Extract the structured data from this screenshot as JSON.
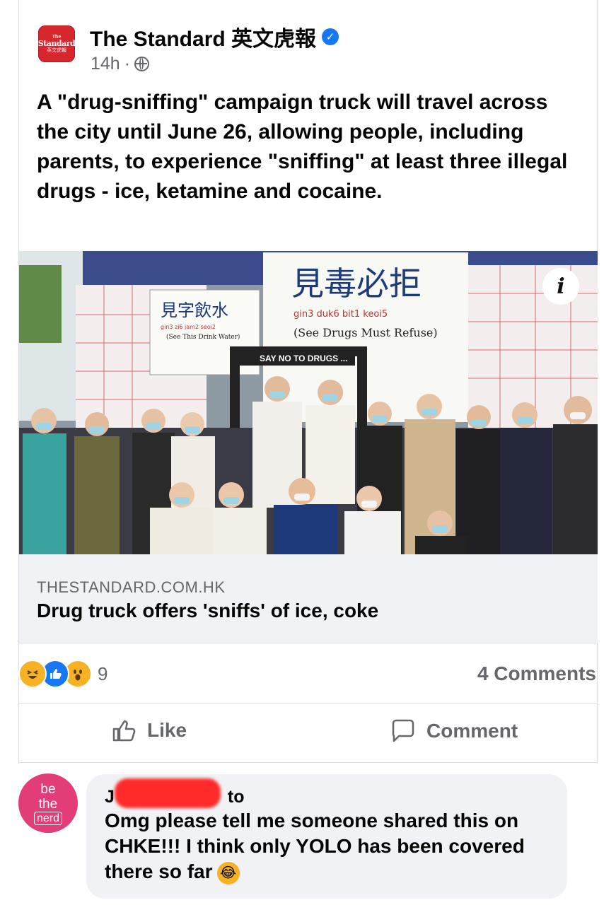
{
  "post": {
    "page_name": "The Standard 英文虎報",
    "avatar_logo": {
      "top": "The",
      "mid": "Standard",
      "bot": "英文虎報"
    },
    "time": "14h",
    "separator": "·",
    "privacy_icon": "globe-icon",
    "text": "A \"drug-sniffing\" campaign truck will travel across the city until June 26, allowing people, including parents, to experience \"sniffing\" at least three illegal drugs - ice, ketamine and cocaine."
  },
  "photo": {
    "banner_main": "見毒必拒",
    "banner_main_romanization": "gin3   duk6   bit1   keoi5",
    "banner_main_translation": "(See Drugs Must Refuse)",
    "banner_left": "見字飲水",
    "banner_left_romanization": "gin3  zi6  jam2  seoi2",
    "banner_left_translation": "(See This Drink Water)",
    "frame_label": "SAY NO TO DRUGS ...",
    "info_icon_glyph": "i"
  },
  "link_card": {
    "domain": "THESTANDARD.COM.HK",
    "title": "Drug truck offers 'sniffs' of ice, coke"
  },
  "reactions": {
    "icons": [
      "haha-icon",
      "like-icon",
      "wow-icon"
    ],
    "count": "9",
    "comments": "4 Comments"
  },
  "actions": {
    "like_label": "Like",
    "comment_label": "Comment"
  },
  "comment": {
    "avatar_lines": [
      "be",
      "the",
      "nerd"
    ],
    "name_start": "J",
    "name_end": "to",
    "text": "Omg please tell me someone shared this on CHKE!!! I think only YOLO has been covered there so far",
    "emoji": "😂"
  },
  "colors": {
    "brand_blue": "#1877f2",
    "secondary_text": "#65676b",
    "card_bg": "#f0f2f5",
    "page_logo_red": "#d8262e",
    "redaction_red": "#ff2a2a"
  }
}
